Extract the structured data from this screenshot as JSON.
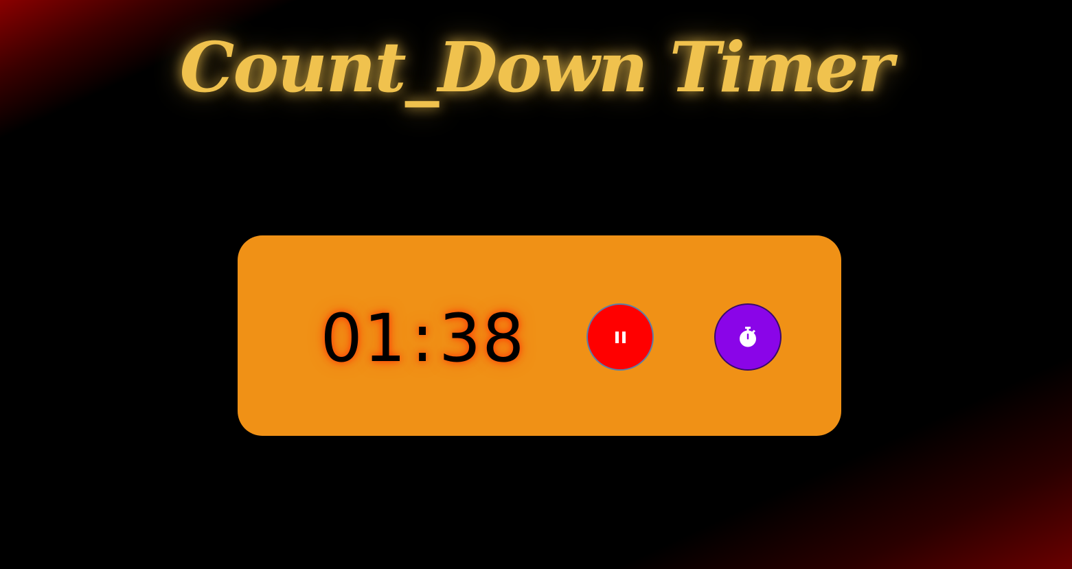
{
  "app": {
    "title": "Count_Down Timer"
  },
  "timer": {
    "minutes": "01",
    "separator": ":",
    "seconds": "38"
  },
  "controls": {
    "pause_icon": "pause-icon",
    "timer_icon": "stopwatch-icon"
  },
  "colors": {
    "title": "#f0c24e",
    "card": "#f09116",
    "pause_button": "#ff0000",
    "timer_button": "#8a05e8",
    "digits": "#000000",
    "digit_glow": "#ff2800"
  }
}
